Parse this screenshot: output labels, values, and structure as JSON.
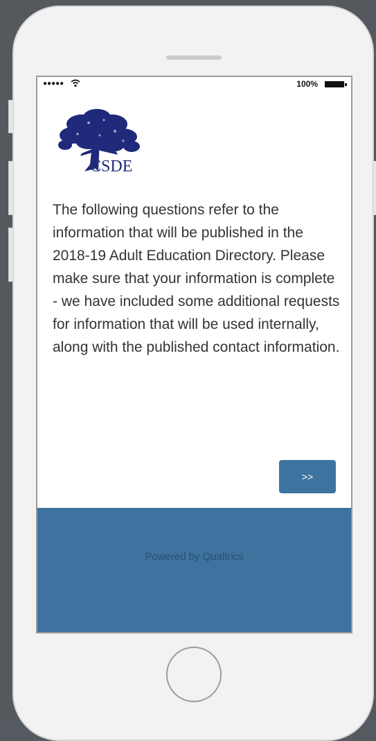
{
  "status_bar": {
    "signal": "●●●●●",
    "wifi_icon": "wifi-icon",
    "battery_percent": "100%",
    "battery_icon": "battery-icon"
  },
  "logo": {
    "text": "CSDE",
    "icon": "oak-tree-icon",
    "color": "#1f2a7a"
  },
  "survey": {
    "intro_text": "The following questions refer to the information that will be published in the 2018-19 Adult Education Directory. Please make sure that your information is complete - we have included some additional requests for information that will be used internally, along with the published contact information.",
    "next_button_label": ">>"
  },
  "footer": {
    "powered_by": "Powered by Qualtrics",
    "background_color": "#3e739f"
  },
  "device": {
    "home_button_icon": "home-button-icon",
    "speaker_icon": "speaker-grill-icon"
  }
}
